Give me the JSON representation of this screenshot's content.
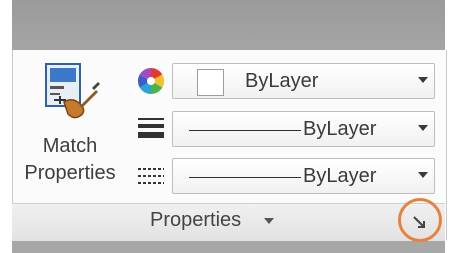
{
  "match_properties": {
    "label_line1": "Match",
    "label_line2": "Properties",
    "icon": "match-properties-icon"
  },
  "rows": [
    {
      "icon": "color-wheel-icon",
      "value": "ByLayer"
    },
    {
      "icon": "lineweight-icon",
      "value": "ByLayer"
    },
    {
      "icon": "linetype-icon",
      "value": "ByLayer"
    }
  ],
  "panel": {
    "title": "Properties",
    "launcher_icon": "dialog-launcher-icon"
  },
  "colors": {
    "highlight": "#e8813f"
  }
}
